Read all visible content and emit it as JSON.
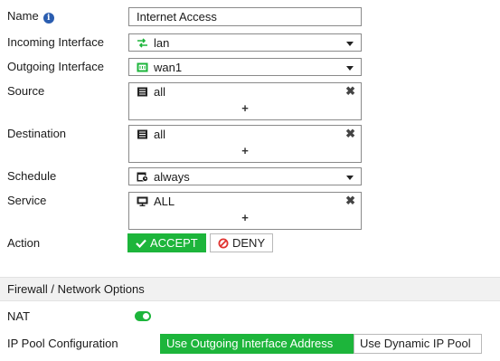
{
  "form": {
    "name": {
      "label": "Name",
      "value": "Internet Access"
    },
    "incoming": {
      "label": "Incoming Interface",
      "value": "lan",
      "icon": "interface-icon"
    },
    "outgoing": {
      "label": "Outgoing Interface",
      "value": "wan1",
      "icon": "port-icon"
    },
    "source": {
      "label": "Source",
      "value": "all",
      "icon": "address-icon",
      "remove": "✖",
      "add": "+"
    },
    "destination": {
      "label": "Destination",
      "value": "all",
      "icon": "address-icon",
      "remove": "✖",
      "add": "+"
    },
    "schedule": {
      "label": "Schedule",
      "value": "always",
      "icon": "schedule-icon"
    },
    "service": {
      "label": "Service",
      "value": "ALL",
      "icon": "service-icon",
      "remove": "✖",
      "add": "+"
    },
    "action": {
      "label": "Action",
      "accept": "ACCEPT",
      "deny": "DENY",
      "selected": "ACCEPT"
    }
  },
  "firewall_options": {
    "header": "Firewall / Network Options",
    "nat": {
      "label": "NAT",
      "enabled": true
    },
    "ip_pool": {
      "label": "IP Pool Configuration",
      "options": [
        "Use Outgoing Interface Address",
        "Use Dynamic IP Pool"
      ],
      "selected": "Use Outgoing Interface Address"
    }
  },
  "colors": {
    "accent_green": "#1db53b",
    "info_blue": "#2a5db0",
    "deny_red": "#e0322f"
  }
}
